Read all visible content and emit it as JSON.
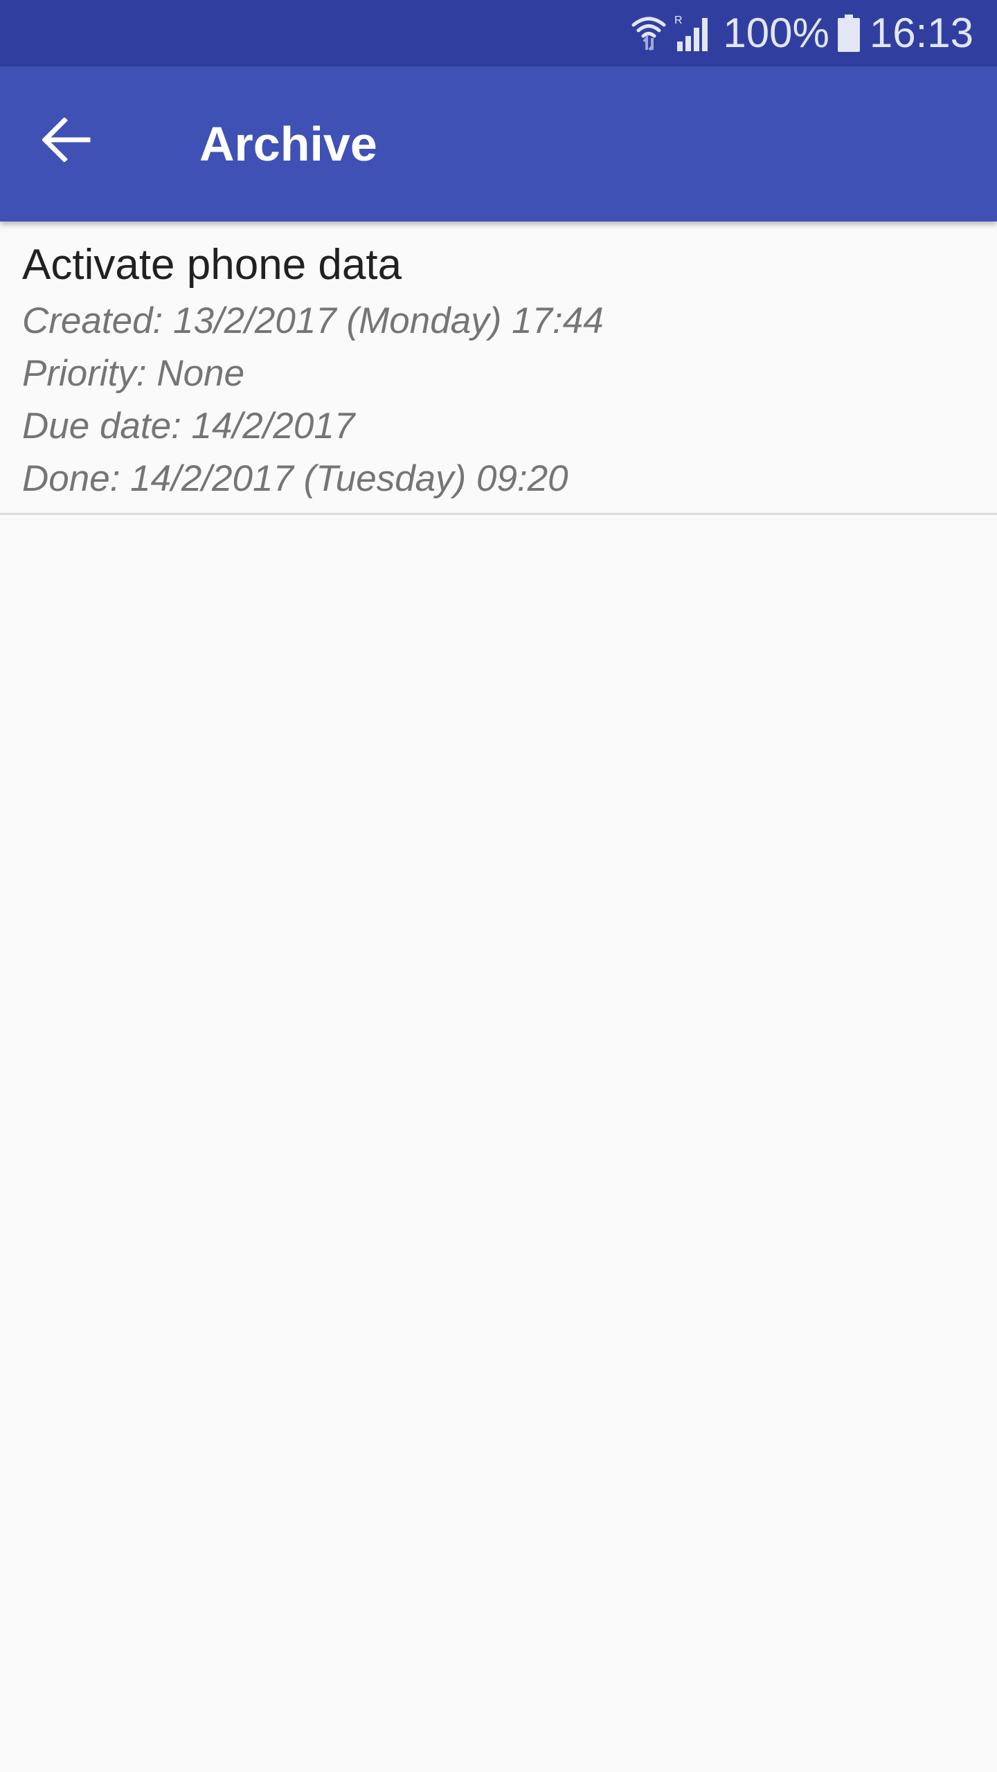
{
  "status_bar": {
    "battery_percent_label": "100%",
    "time": "16:13",
    "icons": [
      "wifi-icon",
      "roaming-signal-icon",
      "battery-icon"
    ]
  },
  "app_bar": {
    "title": "Archive",
    "back_icon": "arrow-left-icon",
    "background_color": "#3F51B5",
    "status_bar_color": "#303F9F"
  },
  "archive_items": [
    {
      "title": "Activate phone data",
      "created": "Created: 13/2/2017 (Monday) 17:44",
      "priority": "Priority: None",
      "due_date": "Due date: 14/2/2017",
      "done": "Done: 14/2/2017 (Tuesday) 09:20"
    }
  ]
}
